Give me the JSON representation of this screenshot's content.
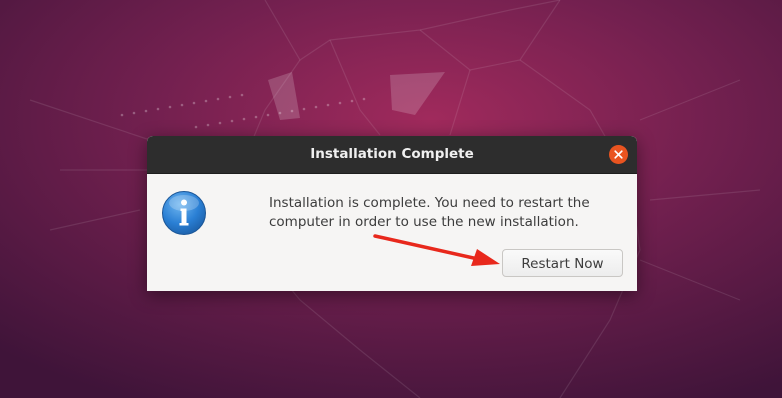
{
  "dialog": {
    "title": "Installation Complete",
    "message": "Installation is complete. You need to restart the computer in order to use the new installation.",
    "restart_label": "Restart Now",
    "icon": "info-icon",
    "close_icon": "close-icon"
  },
  "colors": {
    "wallpaper_primary": "#7a1d52",
    "titlebar": "#2d2d2d",
    "close_button": "#e95420",
    "dialog_body": "#f6f5f4",
    "info_icon": "#2a7fd4",
    "annotation_arrow": "#e8281c"
  }
}
